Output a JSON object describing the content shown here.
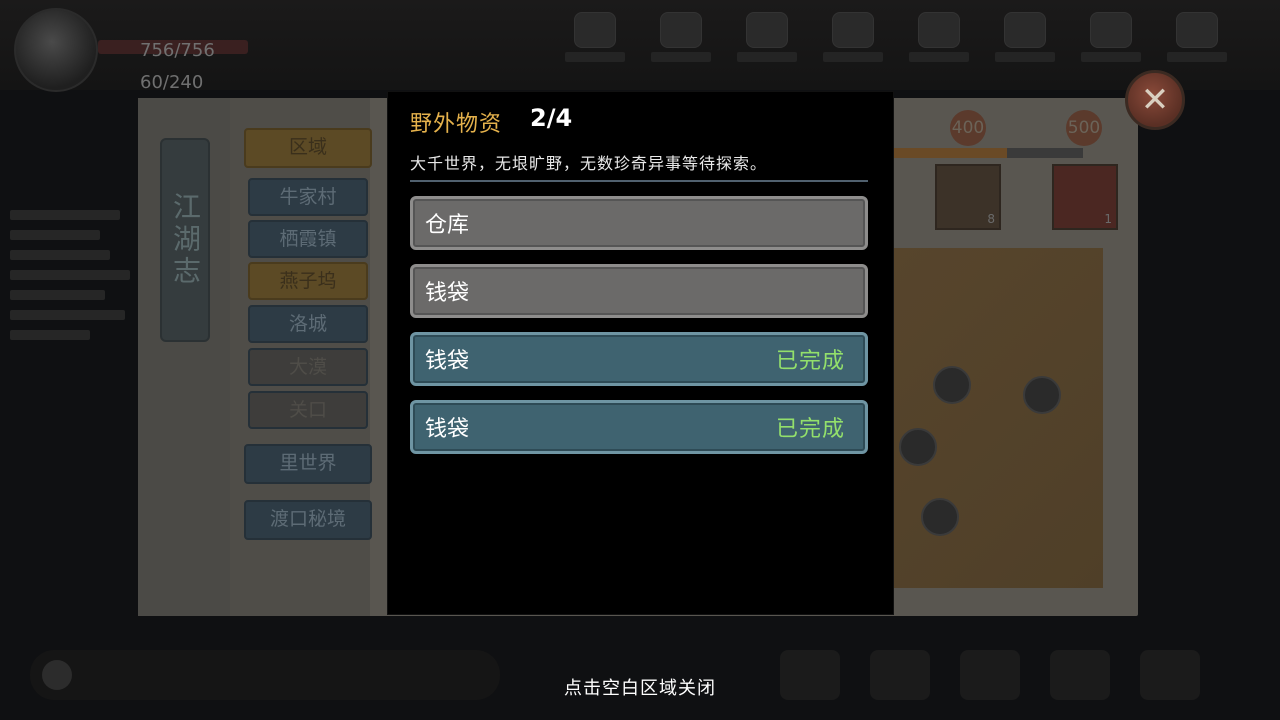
{
  "background": {
    "player": {
      "name": "",
      "hp": "756/756",
      "energy": "60/240"
    },
    "top_menu": [
      "",
      "",
      "",
      "",
      "",
      "",
      "",
      ""
    ],
    "book": {
      "title": "江湖志",
      "region_tab": "区域",
      "regions": [
        {
          "label": "牛家村",
          "state": "normal"
        },
        {
          "label": "栖霞镇",
          "state": "normal"
        },
        {
          "label": "燕子坞",
          "state": "selected"
        },
        {
          "label": "洛城",
          "state": "normal"
        },
        {
          "label": "大漠",
          "state": "locked"
        },
        {
          "label": "关口",
          "state": "locked"
        }
      ],
      "inner_world": "里世界",
      "ferry_realm": "渡口秘境",
      "milestones": [
        "400",
        "500"
      ],
      "reward_counts": [
        "8",
        "1"
      ]
    }
  },
  "modal": {
    "title": "野外物资",
    "count": "2/4",
    "description": "大千世界，无垠旷野，无数珍奇异事等待探索。",
    "items": [
      {
        "name": "仓库",
        "status": "",
        "completed": false
      },
      {
        "name": "钱袋",
        "status": "",
        "completed": false
      },
      {
        "name": "钱袋",
        "status": "已完成",
        "completed": true
      },
      {
        "name": "钱袋",
        "status": "已完成",
        "completed": true
      }
    ]
  },
  "hint": "点击空白区域关闭",
  "colors": {
    "title_gold": "#e5b24c",
    "completed_green": "#93e06b",
    "row_pending": "#6b6a69",
    "row_done": "#3f6370"
  },
  "icons": {
    "close": "close-icon"
  }
}
